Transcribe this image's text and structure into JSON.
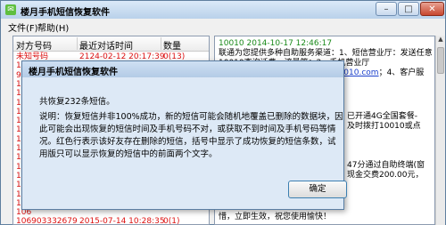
{
  "window": {
    "title": "楼月手机短信恢复软件"
  },
  "menu": {
    "file": "文件(F)",
    "help": "帮助(H)"
  },
  "list": {
    "headers": [
      "对方号码",
      "最近对话时间",
      "数量"
    ],
    "rows": [
      [
        "未知号码",
        "2124-02-12 20:17:39",
        "0(13)"
      ],
      [
        "15",
        "",
        ""
      ],
      [
        "955",
        "",
        ""
      ],
      [
        "10",
        "",
        ""
      ],
      [
        "10",
        "",
        ""
      ],
      [
        "15",
        "",
        ""
      ],
      [
        "10",
        "",
        ""
      ],
      [
        "106",
        "",
        ""
      ],
      [
        "106",
        "",
        ""
      ],
      [
        "106",
        "",
        ""
      ],
      [
        "106",
        "",
        ""
      ],
      [
        "106",
        "",
        ""
      ],
      [
        "106",
        "",
        ""
      ],
      [
        "106",
        "",
        ""
      ],
      [
        "106",
        "",
        ""
      ],
      [
        "106",
        "",
        ""
      ],
      [
        "106",
        "",
        ""
      ],
      [
        "106",
        "",
        ""
      ],
      [
        "106903332679",
        "2015-07-14 10:28:35",
        "0(1)"
      ]
    ]
  },
  "message": {
    "header": "10010 2014-10-17 12:46:17",
    "lines": [
      "联通为您提供多种自助服务渠道：1、短信营业厅：发送任意",
      "10010查询话费、流量等；2、手机营业厅",
      "客户端；3、网上营业厅：www.10010.com；4、客户服",
      "...",
      "...",
      "...",
      "已开通4G全国套餐-",
      "及时拨打10010或点",
      "...",
      "...",
      "47分通过自助终端(窗",
      "现金交费200.00元，",
      "...",
      "惜，立即生效，祝您使用愉快！"
    ],
    "link_text": "10010.com"
  },
  "dialog": {
    "title": "楼月手机短信恢复软件",
    "lines": [
      "共恢复232条短信。",
      "说明：恢复短信并非100%成功，新的短信可能会随机地覆盖已删除的数据块，因",
      "此可能会出现恢复的短信时间及手机号码不对，或获取不到时间及手机号码等情",
      "况。红色行表示该好友存在删除的短信，括号中显示了成功恢复的短信条数，试",
      "用版只可以显示恢复的短信中的前面两个文字。"
    ],
    "ok_label": "确定"
  },
  "icons": {
    "app": "sms-app-icon"
  }
}
